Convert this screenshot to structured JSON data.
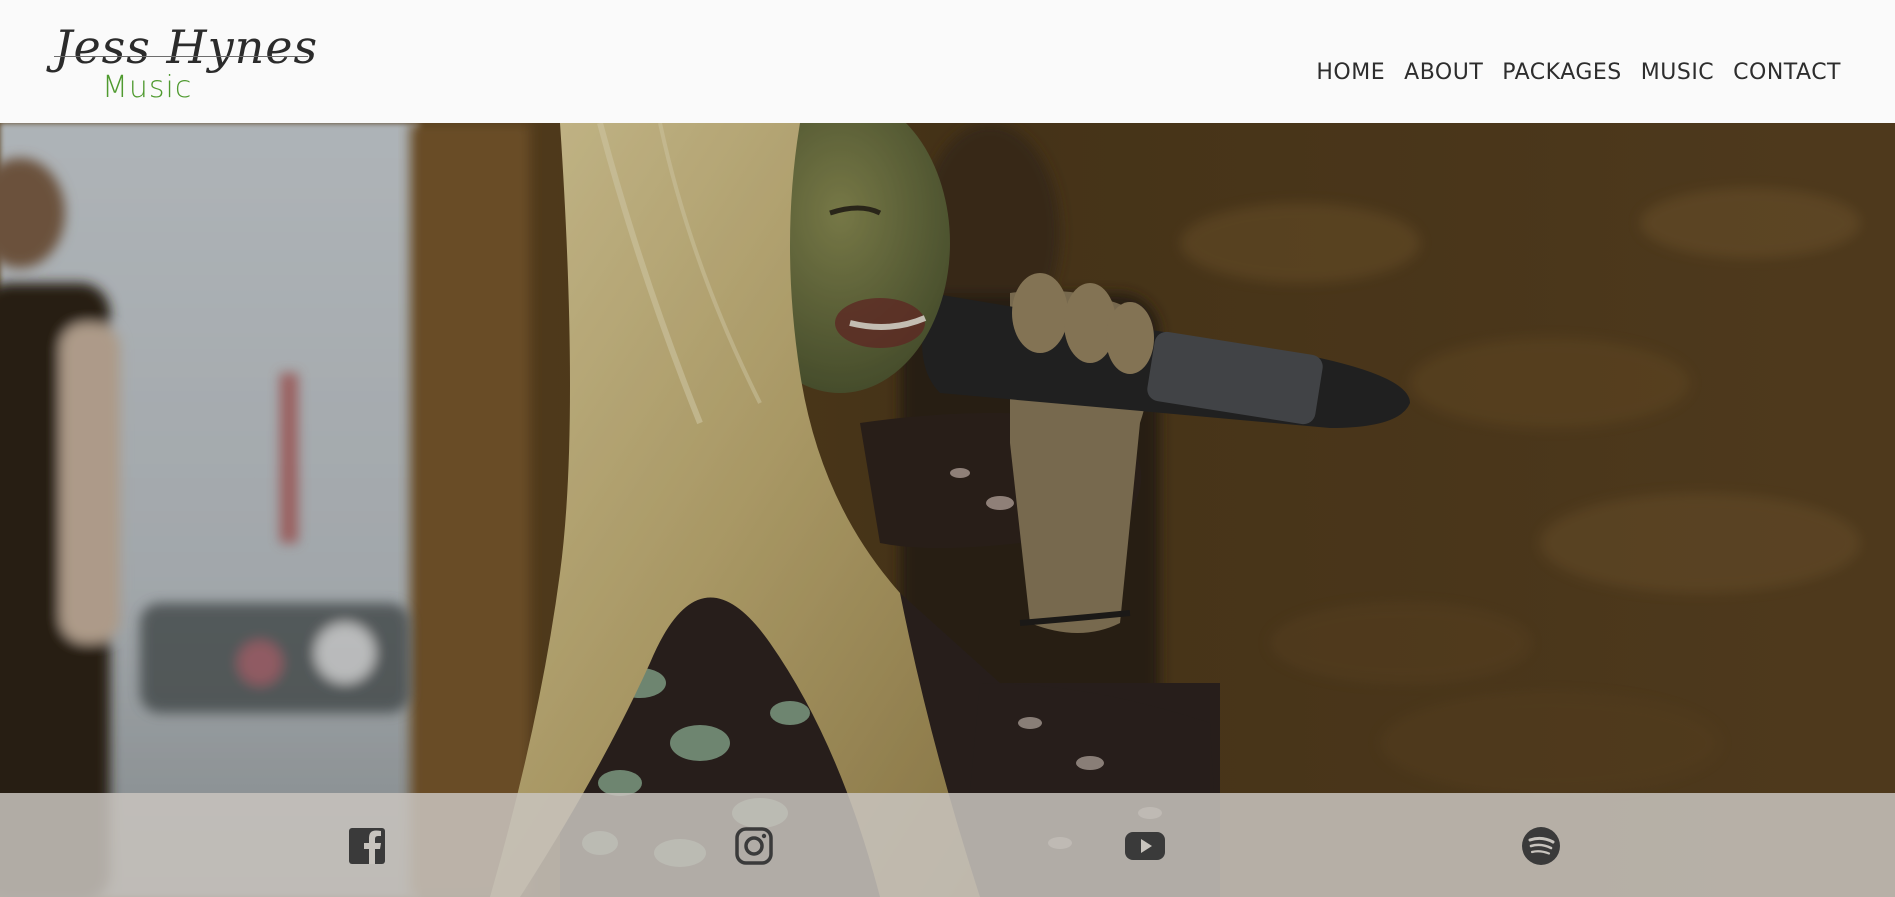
{
  "brand": {
    "script_name": "Jess Hynes",
    "sub_name": "Music"
  },
  "nav": {
    "items": [
      {
        "label": "HOME"
      },
      {
        "label": "ABOUT"
      },
      {
        "label": "PACKAGES"
      },
      {
        "label": "MUSIC"
      },
      {
        "label": "CONTACT"
      }
    ]
  },
  "hero": {
    "image": "singer-with-microphone-photo"
  },
  "social": {
    "icons": [
      "facebook-icon",
      "instagram-icon",
      "youtube-icon",
      "spotify-icon"
    ]
  },
  "colors": {
    "logo_green": "#4f9a2f",
    "nav_text": "#2d2d2d",
    "header_bg": "#fafafa",
    "social_bar_bg": "#c8c4be",
    "icon_color": "#3a3a3a"
  }
}
